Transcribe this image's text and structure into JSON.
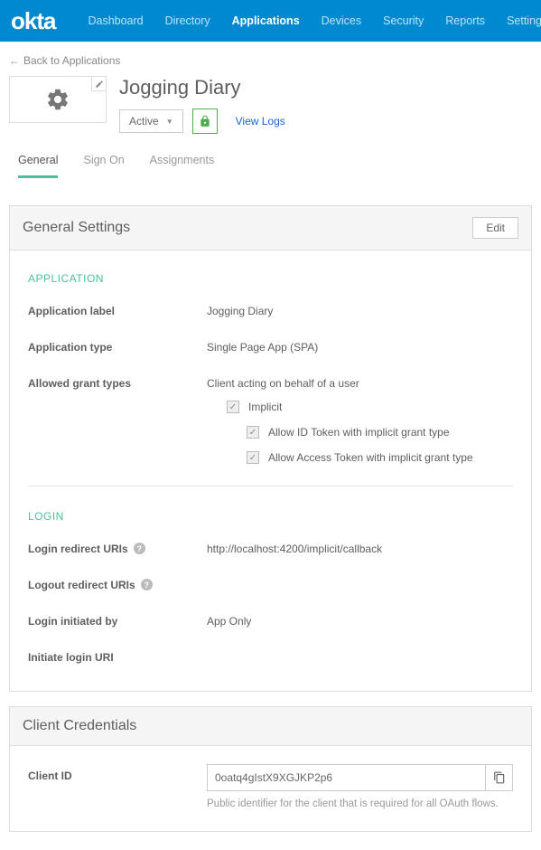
{
  "logo": "okta",
  "nav": {
    "dashboard": "Dashboard",
    "directory": "Directory",
    "applications": "Applications",
    "devices": "Devices",
    "security": "Security",
    "reports": "Reports",
    "settings": "Settings"
  },
  "back_link": "Back to Applications",
  "app": {
    "title": "Jogging Diary",
    "status": "Active",
    "view_logs": "View Logs"
  },
  "tabs": {
    "general": "General",
    "sign_on": "Sign On",
    "assignments": "Assignments"
  },
  "general_settings": {
    "panel_title": "General Settings",
    "edit": "Edit",
    "section_application": "APPLICATION",
    "application_label": {
      "label": "Application label",
      "value": "Jogging Diary"
    },
    "application_type": {
      "label": "Application type",
      "value": "Single Page App (SPA)"
    },
    "allowed_grant_types": {
      "label": "Allowed grant types",
      "sub": "Client acting on behalf of a user",
      "implicit": "Implicit",
      "allow_id_token": "Allow ID Token with implicit grant type",
      "allow_access_token": "Allow Access Token with implicit grant type"
    },
    "section_login": "LOGIN",
    "login_redirect": {
      "label": "Login redirect URIs",
      "value": "http://localhost:4200/implicit/callback"
    },
    "logout_redirect": {
      "label": "Logout redirect URIs",
      "value": ""
    },
    "login_initiated": {
      "label": "Login initiated by",
      "value": "App Only"
    },
    "initiate_login_uri": {
      "label": "Initiate login URI",
      "value": ""
    }
  },
  "client_credentials": {
    "panel_title": "Client Credentials",
    "client_id_label": "Client ID",
    "client_id_value": "0oatq4gIstX9XGJKP2p6",
    "client_id_help": "Public identifier for the client that is required for all OAuth flows."
  }
}
